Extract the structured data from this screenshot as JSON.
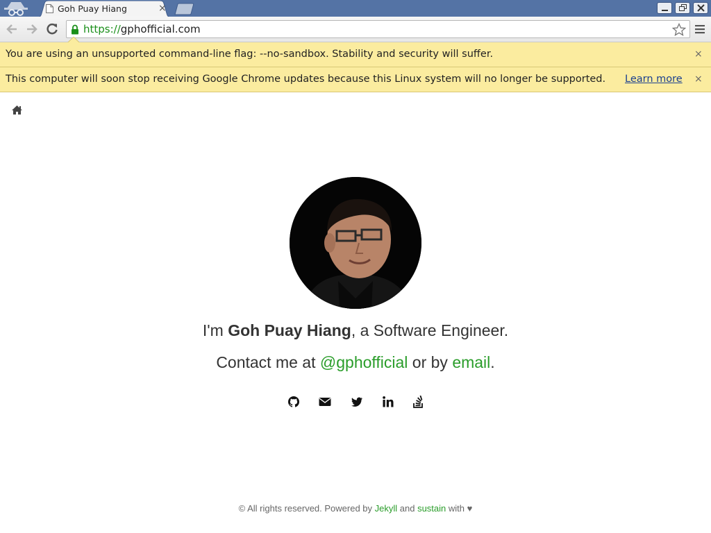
{
  "browser": {
    "tab_title": "Goh Puay Hiang",
    "tab_close": "×",
    "url_scheme": "https://",
    "url_host": "gphofficial.com"
  },
  "infobars": [
    {
      "message": "You are using an unsupported command-line flag: --no-sandbox. Stability and security will suffer.",
      "close": "×"
    },
    {
      "message": "This computer will soon stop receiving Google Chrome updates because this Linux system will no longer be supported.",
      "link": "Learn more",
      "close": "×"
    }
  ],
  "page": {
    "intro_prefix": "I'm ",
    "intro_name": "Goh Puay Hiang",
    "intro_suffix": ", a Software Engineer.",
    "contact_prefix": "Contact me at ",
    "contact_handle": "@gphofficial",
    "contact_middle": " or by ",
    "contact_email": "email",
    "contact_end": ".",
    "social_icons": [
      "github-icon",
      "envelope-icon",
      "twitter-icon",
      "linkedin-icon",
      "stackoverflow-icon"
    ]
  },
  "footer": {
    "prefix": "© All rights reserved. Powered by ",
    "link1": "Jekyll",
    "middle": " and ",
    "link2": "sustain",
    "suffix": " with ♥"
  },
  "colors": {
    "titlebar": "#5473a5",
    "infobar": "#fbec9f",
    "link_green": "#2a9d2a"
  }
}
